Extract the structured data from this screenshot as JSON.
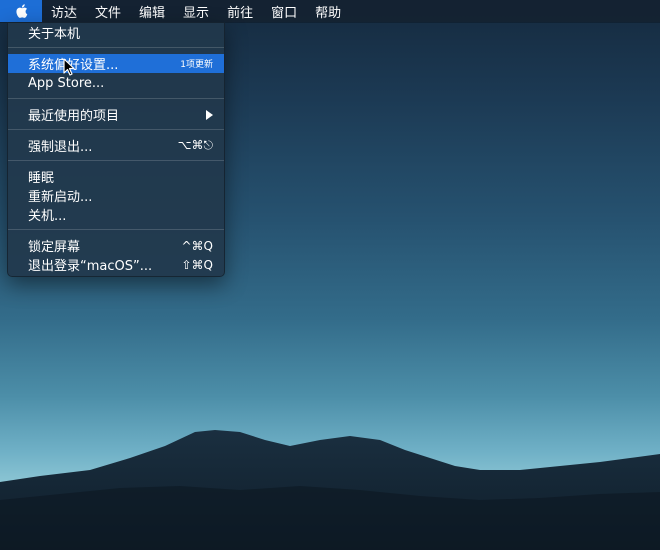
{
  "menubar": {
    "apple_icon": "apple-logo-icon",
    "items": [
      "访达",
      "文件",
      "编辑",
      "显示",
      "前往",
      "窗口",
      "帮助"
    ]
  },
  "apple_menu": {
    "about": "关于本机",
    "system_prefs": "系统偏好设置...",
    "system_prefs_badge": "1项更新",
    "app_store": "App Store...",
    "recent_items": "最近使用的项目",
    "force_quit": "强制退出...",
    "force_quit_shortcut": "⌥⌘⎋",
    "sleep": "睡眠",
    "restart": "重新启动...",
    "shutdown": "关机...",
    "lock_screen": "锁定屏幕",
    "lock_screen_shortcut": "^⌘Q",
    "logout": "退出登录“macOS”...",
    "logout_shortcut": "⇧⌘Q"
  },
  "colors": {
    "menubar_bg": "#14202e",
    "selection": "#1f6fd8",
    "menu_bg": "#22384c"
  },
  "wallpaper": "mountain-dusk-sky"
}
